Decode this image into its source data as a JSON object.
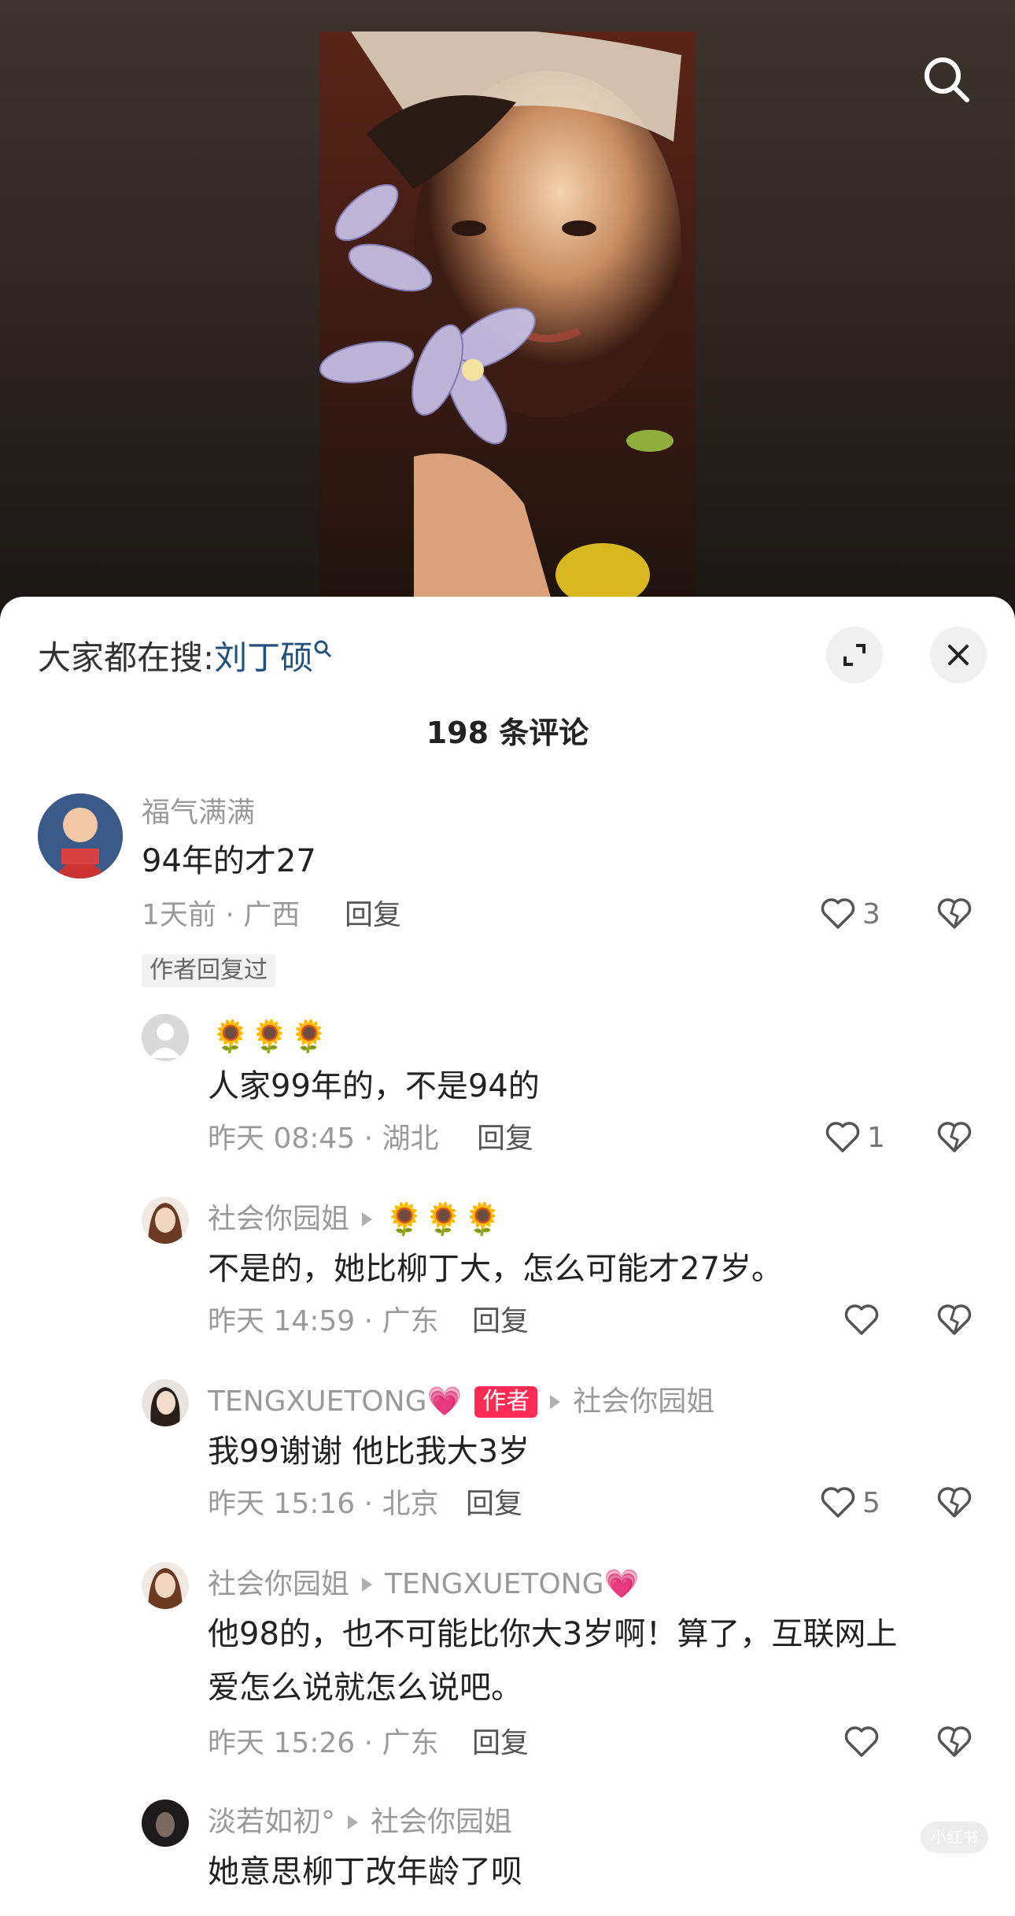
{
  "hot_search": {
    "prefix": "大家都在搜:",
    "keyword": "刘丁硕"
  },
  "comment_count": "198 条评论",
  "comments": [
    {
      "user": "福气满满",
      "text": "94年的才27",
      "time_location": "1天前 · 广西",
      "reply_label": "回复",
      "likes": "3",
      "tag": "作者回复过"
    },
    {
      "user": "",
      "emoji": "🌻🌻🌻",
      "text": "人家99年的，不是94的",
      "time_location": "昨天 08:45 · 湖北",
      "reply_label": "回复",
      "likes": "1"
    },
    {
      "user": "社会你园姐",
      "emoji": "🌻🌻🌻",
      "text": "不是的，她比柳丁大，怎么可能才27岁。",
      "time_location": "昨天 14:59 · 广东",
      "reply_label": "回复",
      "likes": ""
    },
    {
      "user": "TENGXUETONG💗",
      "badge": "作者",
      "reply_to": "社会你园姐",
      "text": "我99谢谢 他比我大3岁",
      "time_location": "昨天 15:16 · 北京",
      "reply_label": "回复",
      "likes": "5"
    },
    {
      "user": "社会你园姐",
      "reply_to": "TENGXUETONG💗",
      "text_line1": "他98的，也不可能比你大3岁啊！算了，互联网上",
      "text_line2": "爱怎么说就怎么说吧。",
      "time_location": "昨天 15:26 · 广东",
      "reply_label": "回复",
      "likes": ""
    },
    {
      "user": "淡若如初°",
      "reply_to": "社会你园姐",
      "text": "她意思柳丁改年龄了呗"
    }
  ],
  "watermark": "小红书",
  "colors": {
    "accent": "#fe2c55",
    "keyword": "#24507e",
    "meta": "#9a9a9a"
  },
  "icons": [
    "search-icon",
    "expand-icon",
    "close-icon",
    "heart-icon",
    "dislike-icon",
    "sunflower-icon"
  ]
}
